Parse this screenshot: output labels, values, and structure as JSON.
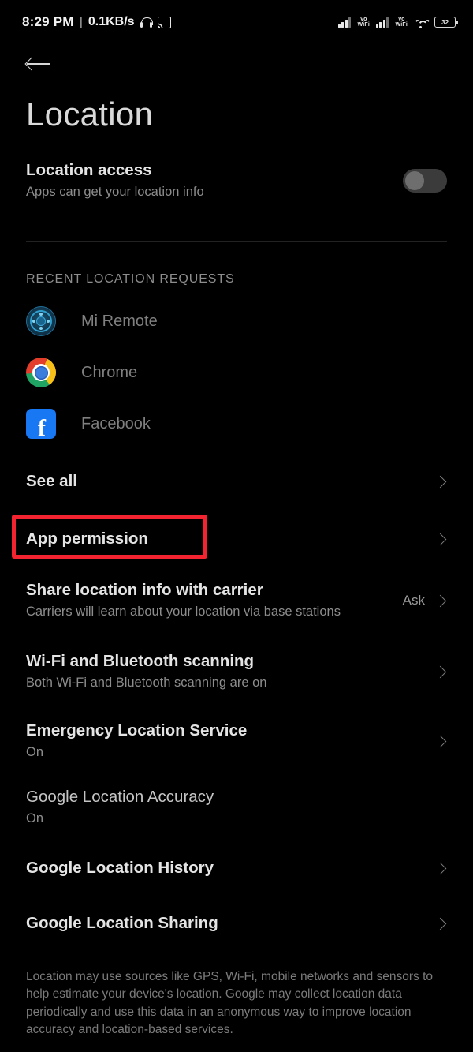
{
  "statusbar": {
    "time": "8:29 PM",
    "separator": "|",
    "data_rate": "0.1KB/s",
    "headphone_icon": "headphone-icon",
    "cast_icon": "cast-icon",
    "sim1_label": "Vo\nWiFi",
    "sim1_line1": "Vo",
    "sim1_line2": "WiFi",
    "sim2_line1": "Vo",
    "sim2_line2": "WiFi",
    "wifi_icon": "wifi-icon",
    "battery_level": "32"
  },
  "header": {
    "back_icon": "back-arrow-icon",
    "title": "Location"
  },
  "location_access": {
    "title": "Location access",
    "subtitle": "Apps can get your location info",
    "toggle_state": "off"
  },
  "recent": {
    "section_label": "RECENT LOCATION REQUESTS",
    "apps": [
      {
        "name": "Mi Remote",
        "icon": "mi-remote-icon"
      },
      {
        "name": "Chrome",
        "icon": "chrome-icon"
      },
      {
        "name": "Facebook",
        "icon": "facebook-icon"
      }
    ],
    "see_all": "See all"
  },
  "settings": [
    {
      "title": "App permission",
      "subtitle": "",
      "value": "",
      "chevron": true,
      "highlighted": true,
      "bold": true
    },
    {
      "title": "Share location info with carrier",
      "subtitle": "Carriers will learn about your location via base stations",
      "value": "Ask",
      "chevron": true,
      "highlighted": false,
      "bold": true
    },
    {
      "title": "Wi-Fi and Bluetooth scanning",
      "subtitle": "Both Wi-Fi and Bluetooth scanning are on",
      "value": "",
      "chevron": true,
      "highlighted": false,
      "bold": true
    },
    {
      "title": "Emergency Location Service",
      "subtitle": "On",
      "value": "",
      "chevron": true,
      "highlighted": false,
      "bold": true
    },
    {
      "title": "Google Location Accuracy",
      "subtitle": "On",
      "value": "",
      "chevron": false,
      "highlighted": false,
      "bold": false
    },
    {
      "title": "Google Location History",
      "subtitle": "",
      "value": "",
      "chevron": true,
      "highlighted": false,
      "bold": true
    },
    {
      "title": "Google Location Sharing",
      "subtitle": "",
      "value": "",
      "chevron": true,
      "highlighted": false,
      "bold": true
    }
  ],
  "footnote": "Location may use sources like GPS, Wi-Fi, mobile networks and sensors to help estimate your device's location. Google may collect location data periodically and use this data in an anonymous way to improve location accuracy and location-based services.",
  "colors": {
    "background": "#000000",
    "highlight": "#f3232f",
    "title_text": "#dadada",
    "sub_text": "#8d8d8d",
    "facebook_blue": "#1877f2"
  }
}
